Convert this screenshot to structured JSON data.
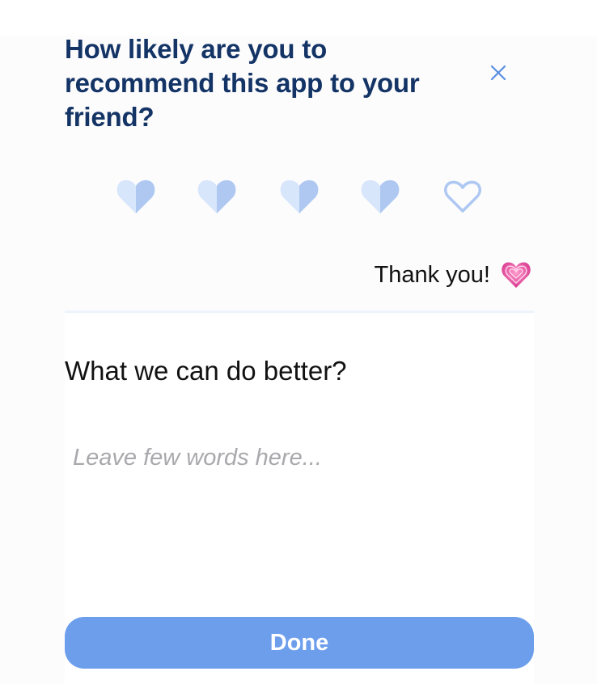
{
  "dialog": {
    "title": "How likely are you to recommend this app to your friend?",
    "close_icon": "close-icon"
  },
  "rating": {
    "max": 5,
    "selected": 4,
    "items": [
      {
        "label": "1",
        "icon": "half-heart-icon",
        "state": "filled"
      },
      {
        "label": "2",
        "icon": "half-heart-icon",
        "state": "filled"
      },
      {
        "label": "3",
        "icon": "half-heart-icon",
        "state": "filled"
      },
      {
        "label": "4",
        "icon": "half-heart-icon",
        "state": "filled"
      },
      {
        "label": "5",
        "icon": "heart-outline-icon",
        "state": "empty"
      }
    ]
  },
  "feedback": {
    "thanks_text": "Thank you!",
    "thanks_icon": "sparkling-heart-icon",
    "question": "What we can do better?",
    "placeholder": "Leave few words here...",
    "value": ""
  },
  "actions": {
    "done_label": "Done"
  },
  "colors": {
    "title": "#143466",
    "accent": "#6c9eec",
    "heart_light": "#d8e6fb",
    "heart_dark": "#aec8f2",
    "close": "#5b8fe0"
  }
}
